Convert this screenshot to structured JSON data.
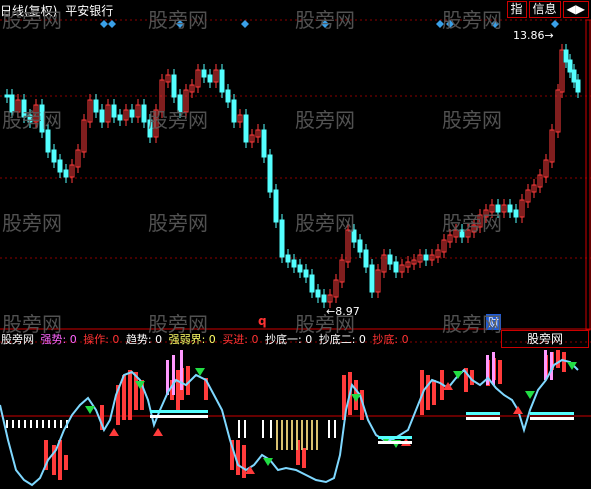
{
  "topbar": {
    "period_label": "日线(复权)",
    "stock_name": "平安银行",
    "btn_index": "指",
    "btn_info": "信息",
    "btn_arrows": "◀▶"
  },
  "price_labels": {
    "high": "13.86→",
    "low": "←8.97",
    "q_mark": "q",
    "cai_mark": "财"
  },
  "watermark": "股旁网",
  "indicator": {
    "name": "股旁网",
    "items": [
      {
        "label": "强势: 0",
        "color": "#ff66ff"
      },
      {
        "label": "操作: 0",
        "color": "#ff3333"
      },
      {
        "label": "趋势: 0",
        "color": "#ffffff"
      },
      {
        "label": "强弱界: 0",
        "color": "#ffff66"
      },
      {
        "label": "买进: 0",
        "color": "#ff3333"
      },
      {
        "label": "抄底一: 0",
        "color": "#ffffff"
      },
      {
        "label": "抄底二: 0",
        "color": "#ffffff"
      },
      {
        "label": "抄底: 0",
        "color": "#ff3333"
      }
    ],
    "tab_label": "股旁网"
  },
  "colors": {
    "up": "#ff3b3b",
    "down": "#54ffff",
    "marker": "#3aa0e8",
    "curve": "#7fd8ff",
    "grid": "#8b0000"
  }
}
